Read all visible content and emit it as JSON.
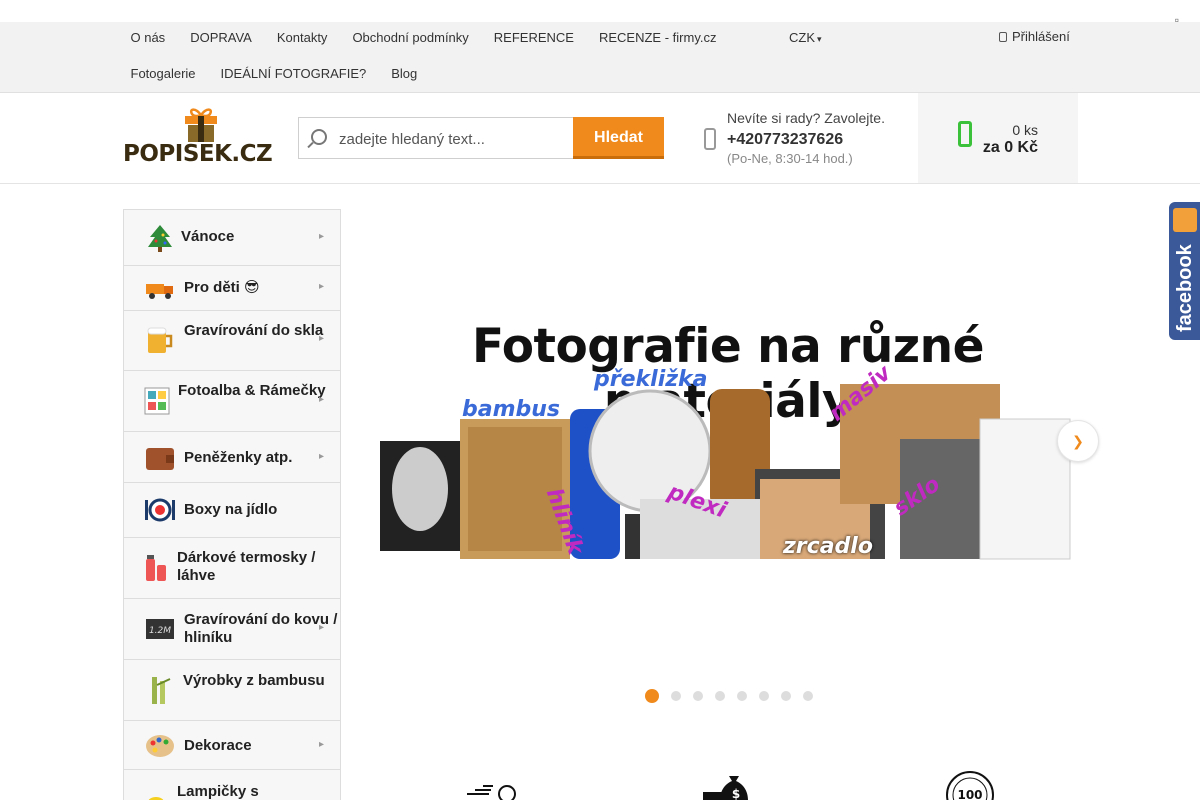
{
  "top_strip": {
    "close_glyph": ""
  },
  "nav": {
    "row1": [
      "O nás",
      "DOPRAVA",
      "Kontakty",
      "Obchodní podmínky",
      "REFERENCE",
      "RECENZE - firmy.cz"
    ],
    "row2": [
      "Fotogalerie",
      "IDEÁLNÍ FOTOGRAFIE?",
      "Blog"
    ],
    "currency": "CZK",
    "login": "Přihlášení"
  },
  "header": {
    "logo_text": "POPISEK.CZ",
    "search_placeholder": "zadejte hledaný text...",
    "search_button": "Hledat",
    "help_question": "Nevíte si rady? Zavolejte.",
    "phone": "+420773237626",
    "hours": "(Po-Ne, 8:30-14 hod.)",
    "cart_qty": "0 ks",
    "cart_total": "za 0 Kč"
  },
  "sidebar": {
    "items": [
      {
        "label": "Vánoce",
        "icon": "christmas-tree-icon",
        "has_children": true
      },
      {
        "label": "Pro děti 😎",
        "icon": "toy-truck-icon",
        "has_children": true
      },
      {
        "label": "Gravírování do skla",
        "icon": "beer-mug-icon",
        "has_children": true
      },
      {
        "label": "Fotoalba & Rámečky",
        "icon": "photo-album-icon",
        "has_children": true
      },
      {
        "label": "Peněženky atp.",
        "icon": "wallet-icon",
        "has_children": true
      },
      {
        "label": "Boxy na jídlo",
        "icon": "lunch-box-icon",
        "has_children": false
      },
      {
        "label": "Dárkové termosky / láhve",
        "icon": "thermos-icon",
        "has_children": false
      },
      {
        "label": "Gravírování do kovu / hliníku",
        "icon": "metal-plate-icon",
        "has_children": true
      },
      {
        "label": "Výrobky z bambusu",
        "icon": "bamboo-icon",
        "has_children": false
      },
      {
        "label": "Dekorace",
        "icon": "palette-icon",
        "has_children": true
      },
      {
        "label": "Lampičky s",
        "icon": "lamp-icon",
        "has_children": false
      }
    ]
  },
  "slider": {
    "title": "Fotografie na různé materiály",
    "tags": [
      "bambus",
      "překližka",
      "masiv",
      "hliník",
      "plexi",
      "zrcadlo",
      "sklo"
    ],
    "dots_total": 8,
    "active_dot": 1
  },
  "colors": {
    "accent": "#f08a1c",
    "cart_icon": "#3cc23a",
    "facebook": "#3b5998"
  },
  "facebook_label": "facebook"
}
